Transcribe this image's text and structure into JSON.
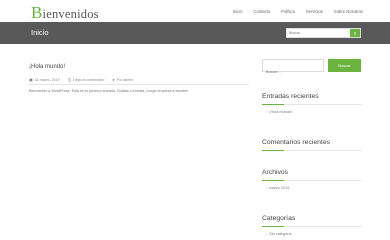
{
  "site": {
    "logo_initial": "B",
    "logo_rest": "ienvenidos"
  },
  "nav": {
    "items": [
      {
        "label": "Inicio"
      },
      {
        "label": "Contacto"
      },
      {
        "label": "Política"
      },
      {
        "label": "Servicios"
      },
      {
        "label": "Sobre Nosotros"
      }
    ]
  },
  "page": {
    "title": "Inicio"
  },
  "header_search": {
    "placeholder": "Buscar",
    "icon": "search-icon"
  },
  "post": {
    "title": "¡Hola mundo!",
    "date": "31 marzo, 2019",
    "comments": "Deja un comentario",
    "author": "Por admin",
    "excerpt": "Bienvenido a WordPress. Esta es tu primera entrada. Edítala o bórrala, ¡luego empieza a escribir!"
  },
  "sidebar": {
    "search": {
      "placeholder": "Buscar …",
      "button_label": "Buscar"
    },
    "recent_posts": {
      "title": "Entradas recientes",
      "items": [
        "¡Hola mundo!"
      ]
    },
    "recent_comments": {
      "title": "Comentarios recientes"
    },
    "archives": {
      "title": "Archivos",
      "items": [
        "marzo 2019"
      ]
    },
    "categories": {
      "title": "Categorías",
      "items": [
        "Sin categoría"
      ]
    }
  },
  "colors": {
    "accent": "#6ab43e",
    "title_bar": "#595959"
  }
}
